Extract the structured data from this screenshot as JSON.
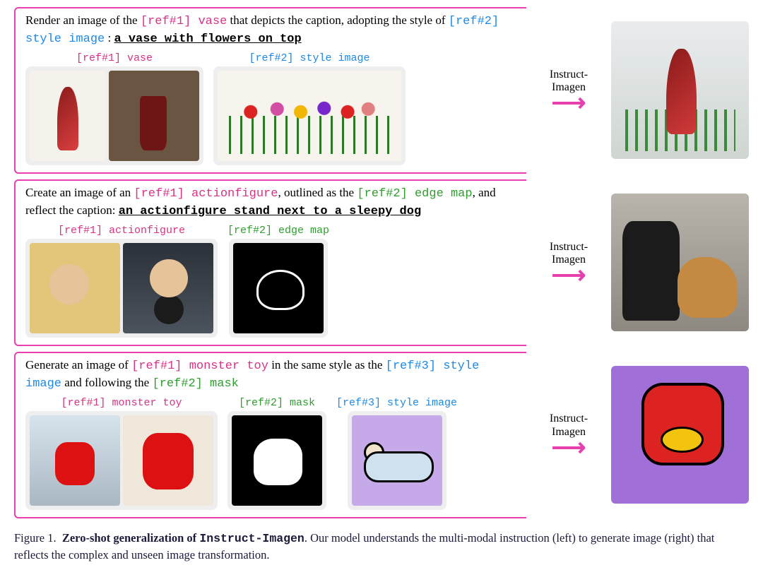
{
  "model_name": "Instruct-Imagen",
  "arrow_label_line1": "Instruct-",
  "arrow_label_line2": "Imagen",
  "rows": [
    {
      "prompt_pre": "Render an image of the ",
      "ref1_tag": "[ref#1] vase",
      "prompt_mid1": " that depicts the caption, adopting the style of ",
      "ref2_tag": "[ref#2] style image",
      "prompt_mid2": " : ",
      "caption": "a vase with flowers on top",
      "ref1_label": "[ref#1] vase",
      "ref2_label": "[ref#2] style image",
      "ref2_color": "blue"
    },
    {
      "prompt_pre": "Create an image of an ",
      "ref1_tag": "[ref#1] actionfigure",
      "prompt_mid1": ", outlined as the ",
      "ref2_tag": "[ref#2] edge map",
      "prompt_mid2": ", and reflect the caption: ",
      "caption": "an actionfigure stand next to a sleepy dog",
      "ref1_label": "[ref#1] actionfigure",
      "ref2_label": "[ref#2] edge map",
      "ref2_color": "green"
    },
    {
      "prompt_pre": "Generate an image of ",
      "ref1_tag": "[ref#1] monster toy",
      "prompt_mid1": " in the same style as the ",
      "ref3_tag": "[ref#3] style image",
      "prompt_mid2": " and following the ",
      "ref2_tag": "[ref#2] mask",
      "ref1_label": "[ref#1] monster toy",
      "ref2_label": "[ref#2] mask",
      "ref3_label": "[ref#3] style image"
    }
  ],
  "caption": {
    "lead": "Figure 1.",
    "bold_title": "Zero-shot generalization of ",
    "code": "Instruct-Imagen",
    "rest": ". Our model understands the multi-modal instruction (left) to generate image (right) that reflects the complex and unseen image transformation."
  }
}
